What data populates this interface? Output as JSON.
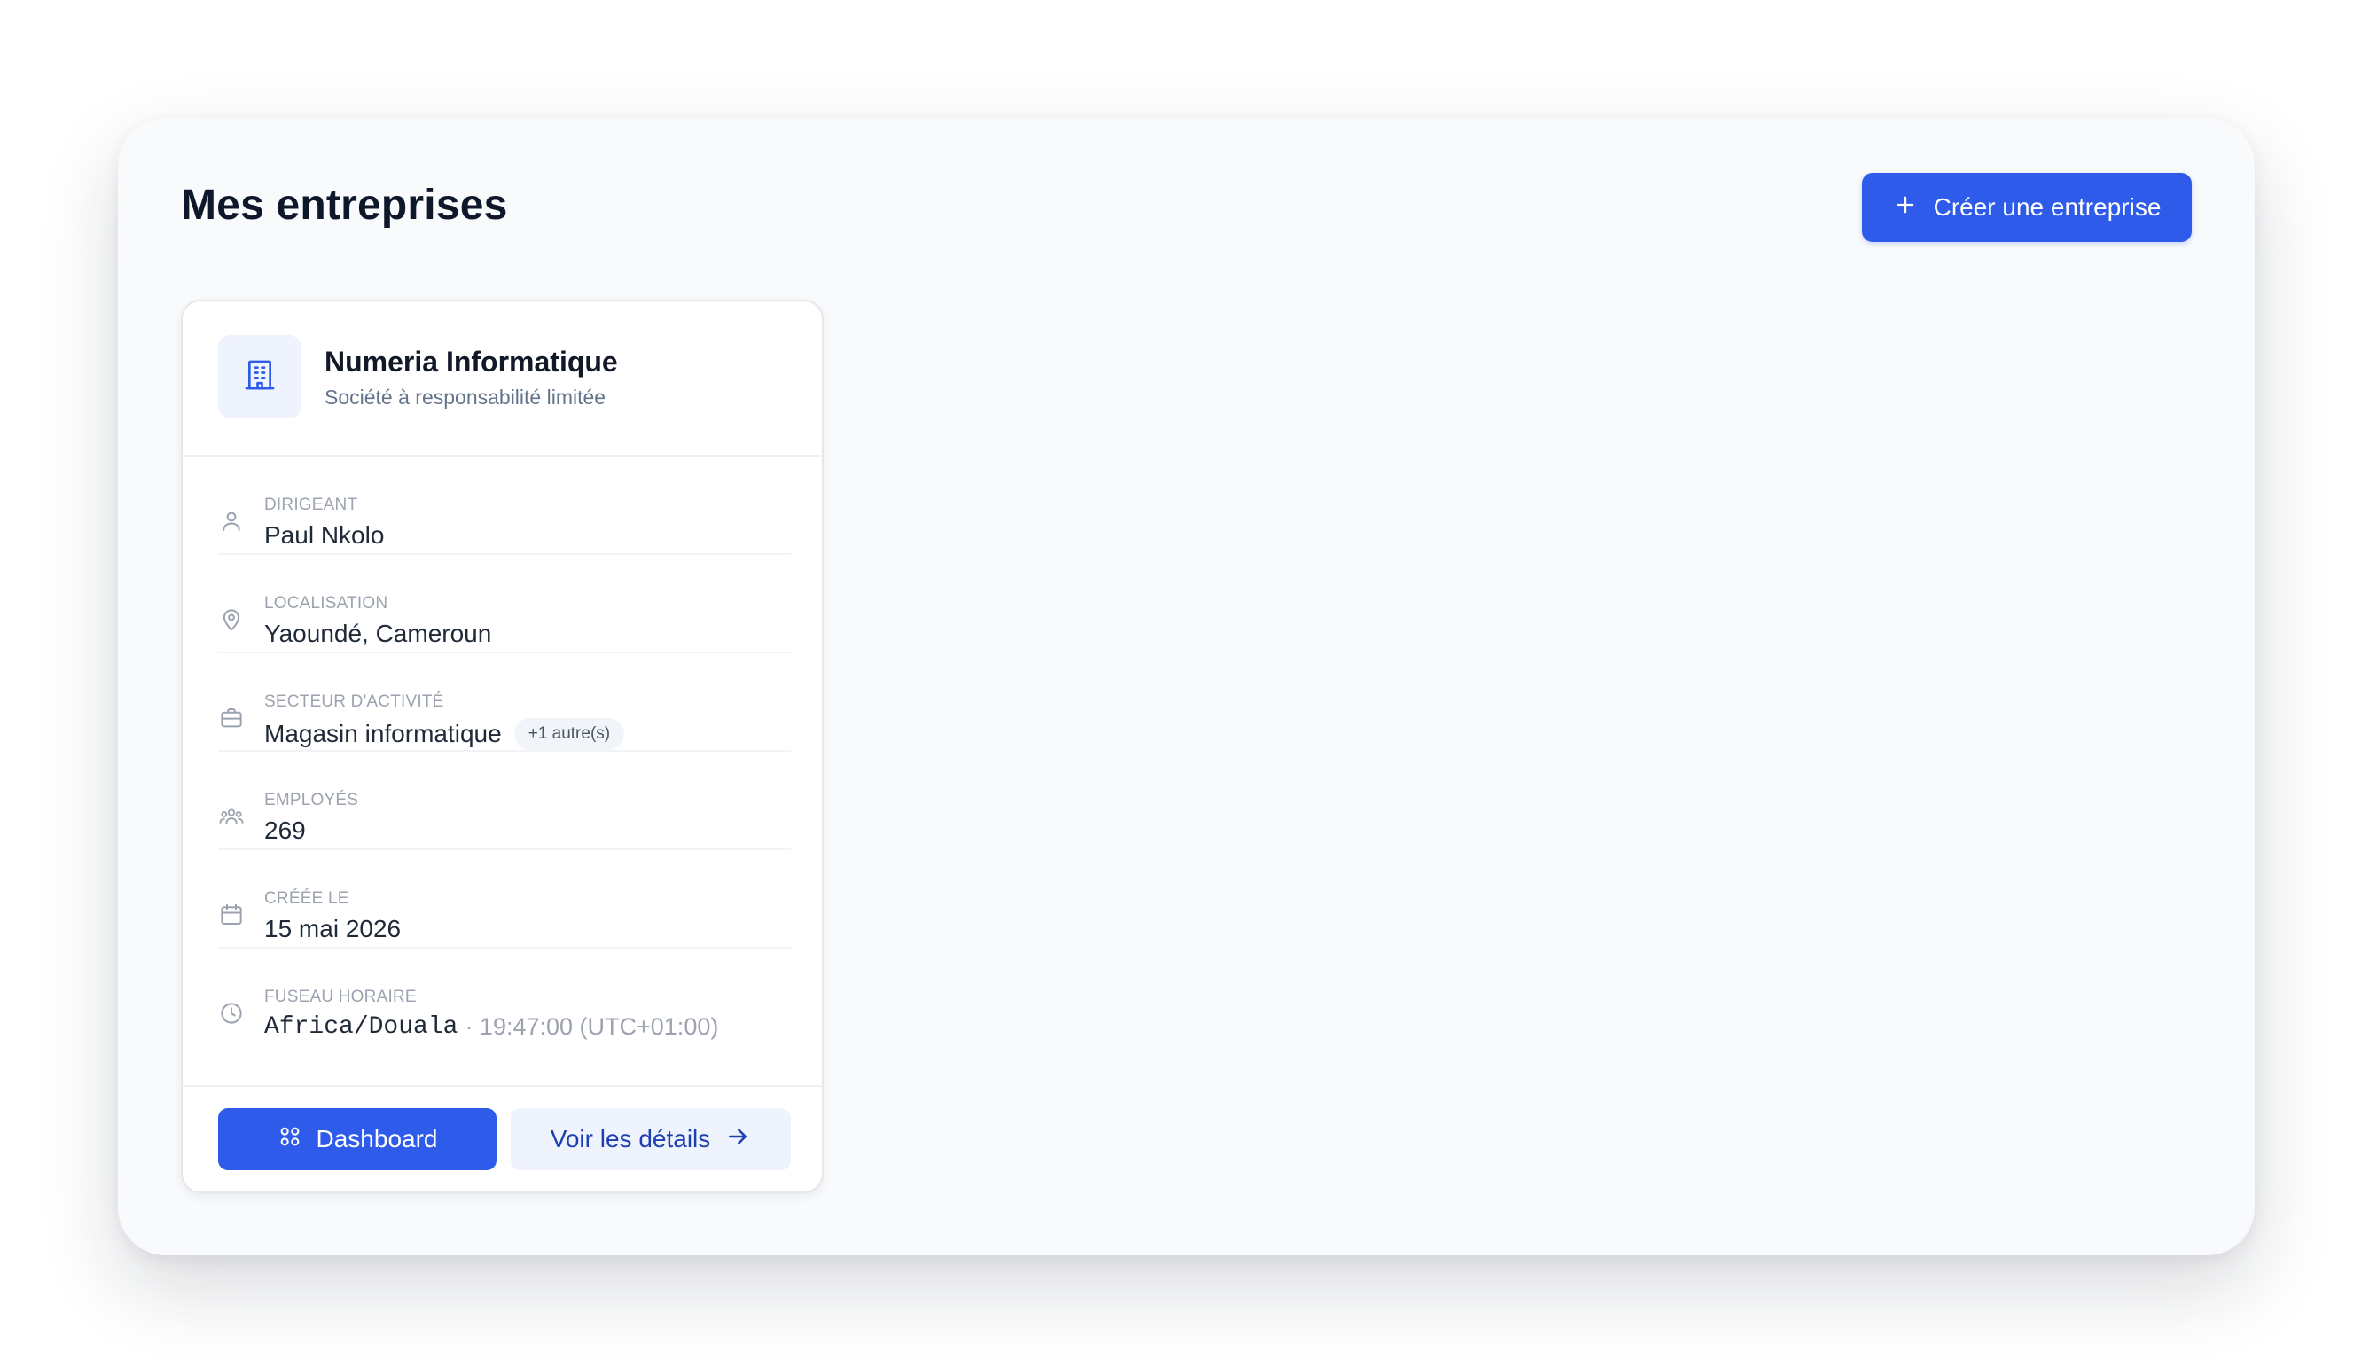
{
  "header": {
    "title": "Mes entreprises",
    "create_button_label": "Créer une entreprise"
  },
  "company": {
    "name": "Numeria Informatique",
    "type": "Société à responsabilité limitée",
    "fields": {
      "leader": {
        "label": "Dirigeant",
        "value": "Paul Nkolo"
      },
      "location": {
        "label": "Localisation",
        "value": "Yaoundé, Cameroun"
      },
      "sector": {
        "label": "Secteur d'activité",
        "value": "Magasin informatique",
        "extra_badge": "+1 autre(s)"
      },
      "employees": {
        "label": "Employés",
        "value": "269"
      },
      "created": {
        "label": "Créée le",
        "value": "15 mai 2026"
      },
      "timezone": {
        "label": "Fuseau horaire",
        "zone": "Africa/Douala",
        "detail": "· 19:47:00 (UTC+01:00)"
      }
    },
    "actions": {
      "dashboard_label": "Dashboard",
      "details_label": "Voir les détails"
    }
  },
  "icons": {
    "create": "plus-icon",
    "logo": "building-icon",
    "leader": "user-icon",
    "location": "map-pin-icon",
    "sector": "briefcase-icon",
    "employees": "users-icon",
    "created": "calendar-icon",
    "timezone": "clock-icon",
    "dashboard": "grid-icon",
    "details": "arrow-right-icon"
  },
  "colors": {
    "primary": "#2f5bea",
    "primary_soft": "#eef3fe",
    "panel_bg": "#f8fafc",
    "muted_text": "#9ca3af"
  }
}
